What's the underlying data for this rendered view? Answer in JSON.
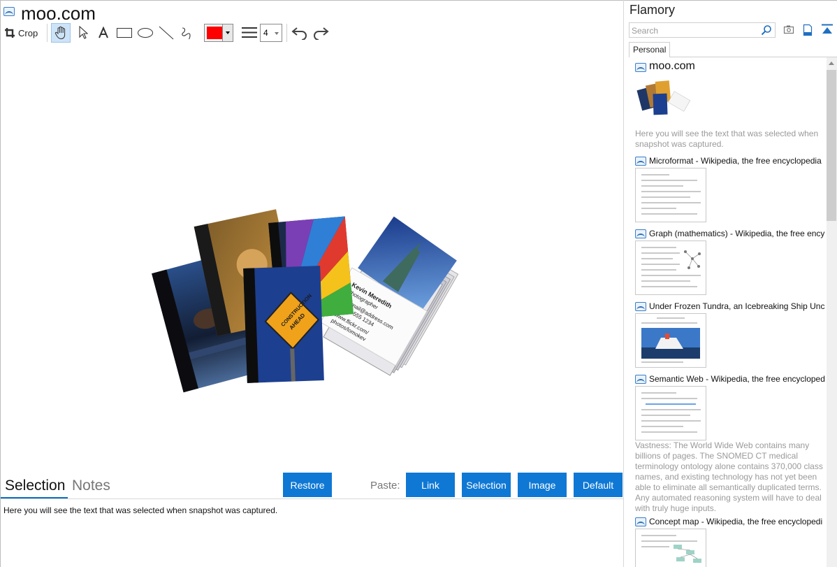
{
  "window": {
    "title": "moo.com"
  },
  "toolbar": {
    "crop_label": "Crop",
    "line_width": "4",
    "color": "#ff0000",
    "tools": [
      "hand-icon",
      "pointer-icon",
      "text-icon",
      "rectangle-icon",
      "ellipse-icon",
      "line-icon",
      "freehand-icon"
    ]
  },
  "canvas": {
    "card_texts": {
      "sign_line1": "CONSTRUCTION",
      "sign_line2": "AHEAD",
      "card_name": "Kevin Meredith",
      "card_role": "Photographer",
      "card_email": "e: email@address.com",
      "card_tel": "t: 831 555 1234",
      "card_web1": "www.flickr.com/",
      "card_web2": "photos/lomokev"
    }
  },
  "bottom": {
    "tabs": [
      "Selection",
      "Notes"
    ],
    "restore_label": "Restore",
    "paste_label": "Paste:",
    "paste_buttons": [
      "Link",
      "Selection",
      "Image",
      "Default"
    ],
    "selection_text": "Here you will see the text that was selected when snapshot was captured."
  },
  "panel": {
    "title": "Flamory",
    "search_placeholder": "Search",
    "tab": "Personal",
    "entries": [
      {
        "title": "moo.com",
        "desc": "Here you will see the text that was selected when snapshot was captured."
      },
      {
        "title": "Microformat - Wikipedia, the free encyclopedia"
      },
      {
        "title": "Graph (mathematics) - Wikipedia, the free ency"
      },
      {
        "title": "Under Frozen Tundra, an Icebreaking Ship Unco"
      },
      {
        "title": "Semantic Web - Wikipedia, the free encycloped",
        "desc": "Vastness: The World Wide Web contains many billions of pages. The SNOMED CT medical terminology ontology alone contains 370,000 class names, and existing technology has not yet been able to eliminate all semantically duplicated terms. Any automated reasoning system will have to deal with truly huge inputs."
      },
      {
        "title": "Concept map - Wikipedia, the free encyclopedi"
      }
    ]
  }
}
